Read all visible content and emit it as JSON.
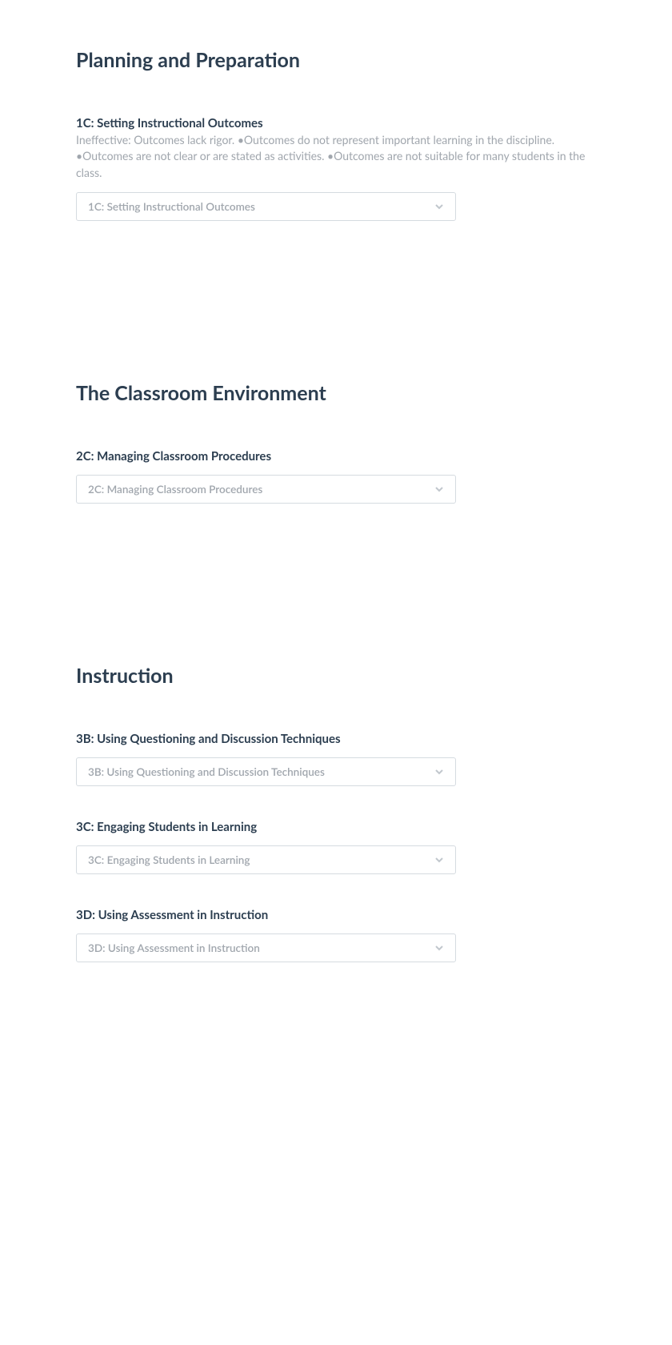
{
  "sections": [
    {
      "title": "Planning and Preparation",
      "subsections": [
        {
          "title": "1C: Setting Instructional Outcomes",
          "description": "Ineffective: Outcomes lack rigor. •Outcomes do not represent important learning in the discipline. •Outcomes are not clear or are stated as activities. •Outcomes are not suitable for many students in the class.",
          "select_label": "1C: Setting Instructional Outcomes"
        }
      ]
    },
    {
      "title": "The Classroom Environment",
      "subsections": [
        {
          "title": "2C: Managing Classroom Procedures",
          "select_label": "2C: Managing Classroom Procedures"
        }
      ]
    },
    {
      "title": "Instruction",
      "subsections": [
        {
          "title": "3B: Using Questioning and Discussion Techniques",
          "select_label": "3B: Using Questioning and Discussion Techniques"
        },
        {
          "title": "3C: Engaging Students in Learning",
          "select_label": "3C: Engaging Students in Learning"
        },
        {
          "title": "3D: Using Assessment in Instruction",
          "select_label": "3D: Using Assessment in Instruction"
        }
      ]
    }
  ]
}
